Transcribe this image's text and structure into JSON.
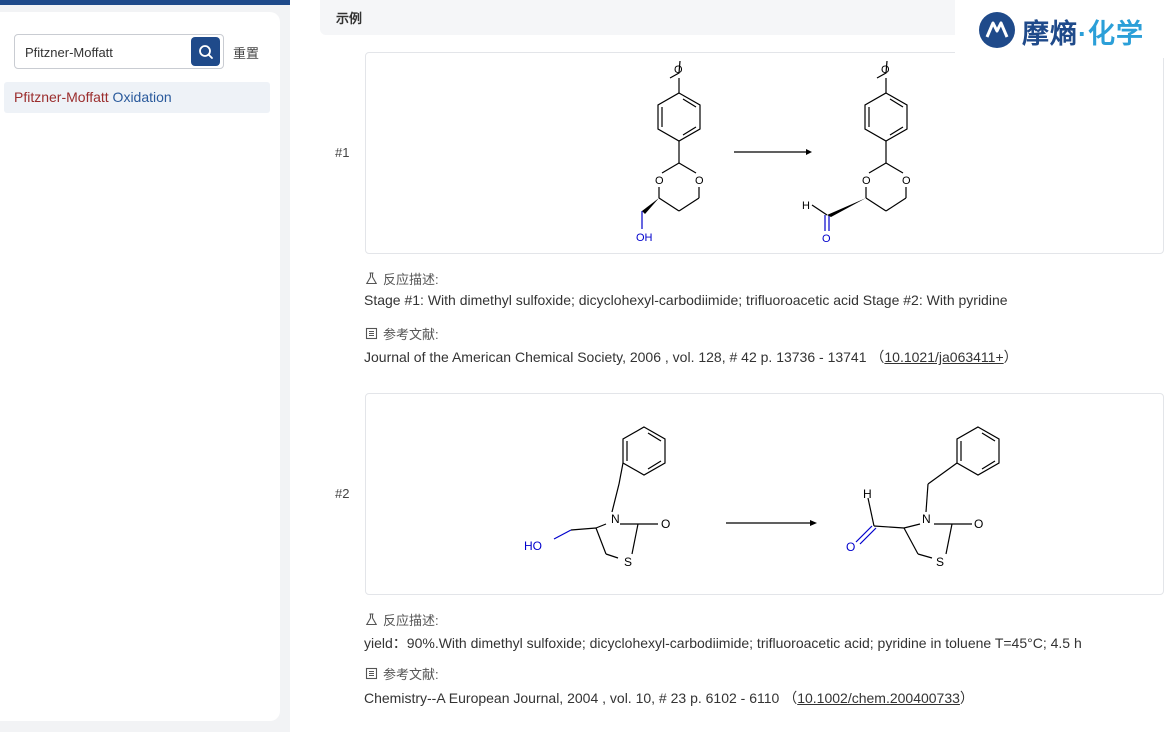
{
  "search": {
    "value": "Pfitzner-Moffatt",
    "reset_label": "重置"
  },
  "results": [
    {
      "highlight": "Pfitzner-Moffatt",
      "rest": " Oxidation"
    }
  ],
  "section": {
    "title": "示例"
  },
  "brand": {
    "name_main": "摩熵",
    "name_sep": "·",
    "name_accent": "化学",
    "accent_color": "#2b9fd8",
    "primary_color": "#1f4a8a"
  },
  "examples": [
    {
      "index": "#1",
      "desc_label": "反应描述:",
      "desc": "Stage #1: With dimethyl sulfoxide; dicyclohexyl-carbodiimide; trifluoroacetic acid Stage #2: With pyridine",
      "ref_label": "参考文献:",
      "ref": "Journal of the American Chemical Society, 2006 , vol. 128, # 42 p. 13736 - 13741",
      "doi": "10.1021/ja063411+",
      "atoms": {
        "o": "O",
        "oh": "OH",
        "h": "H"
      }
    },
    {
      "index": "#2",
      "desc_label": "反应描述:",
      "desc": "yield：90%.With dimethyl sulfoxide; dicyclohexyl-carbodiimide; trifluoroacetic acid; pyridine in toluene T=45°C; 4.5 h",
      "ref_label": "参考文献:",
      "ref": "Chemistry--A European Journal, 2004 , vol. 10, # 23 p. 6102 - 6110",
      "doi": "10.1002/chem.200400733",
      "atoms": {
        "ho": "HO",
        "n": "N",
        "o": "O",
        "s": "S",
        "h": "H"
      }
    }
  ]
}
